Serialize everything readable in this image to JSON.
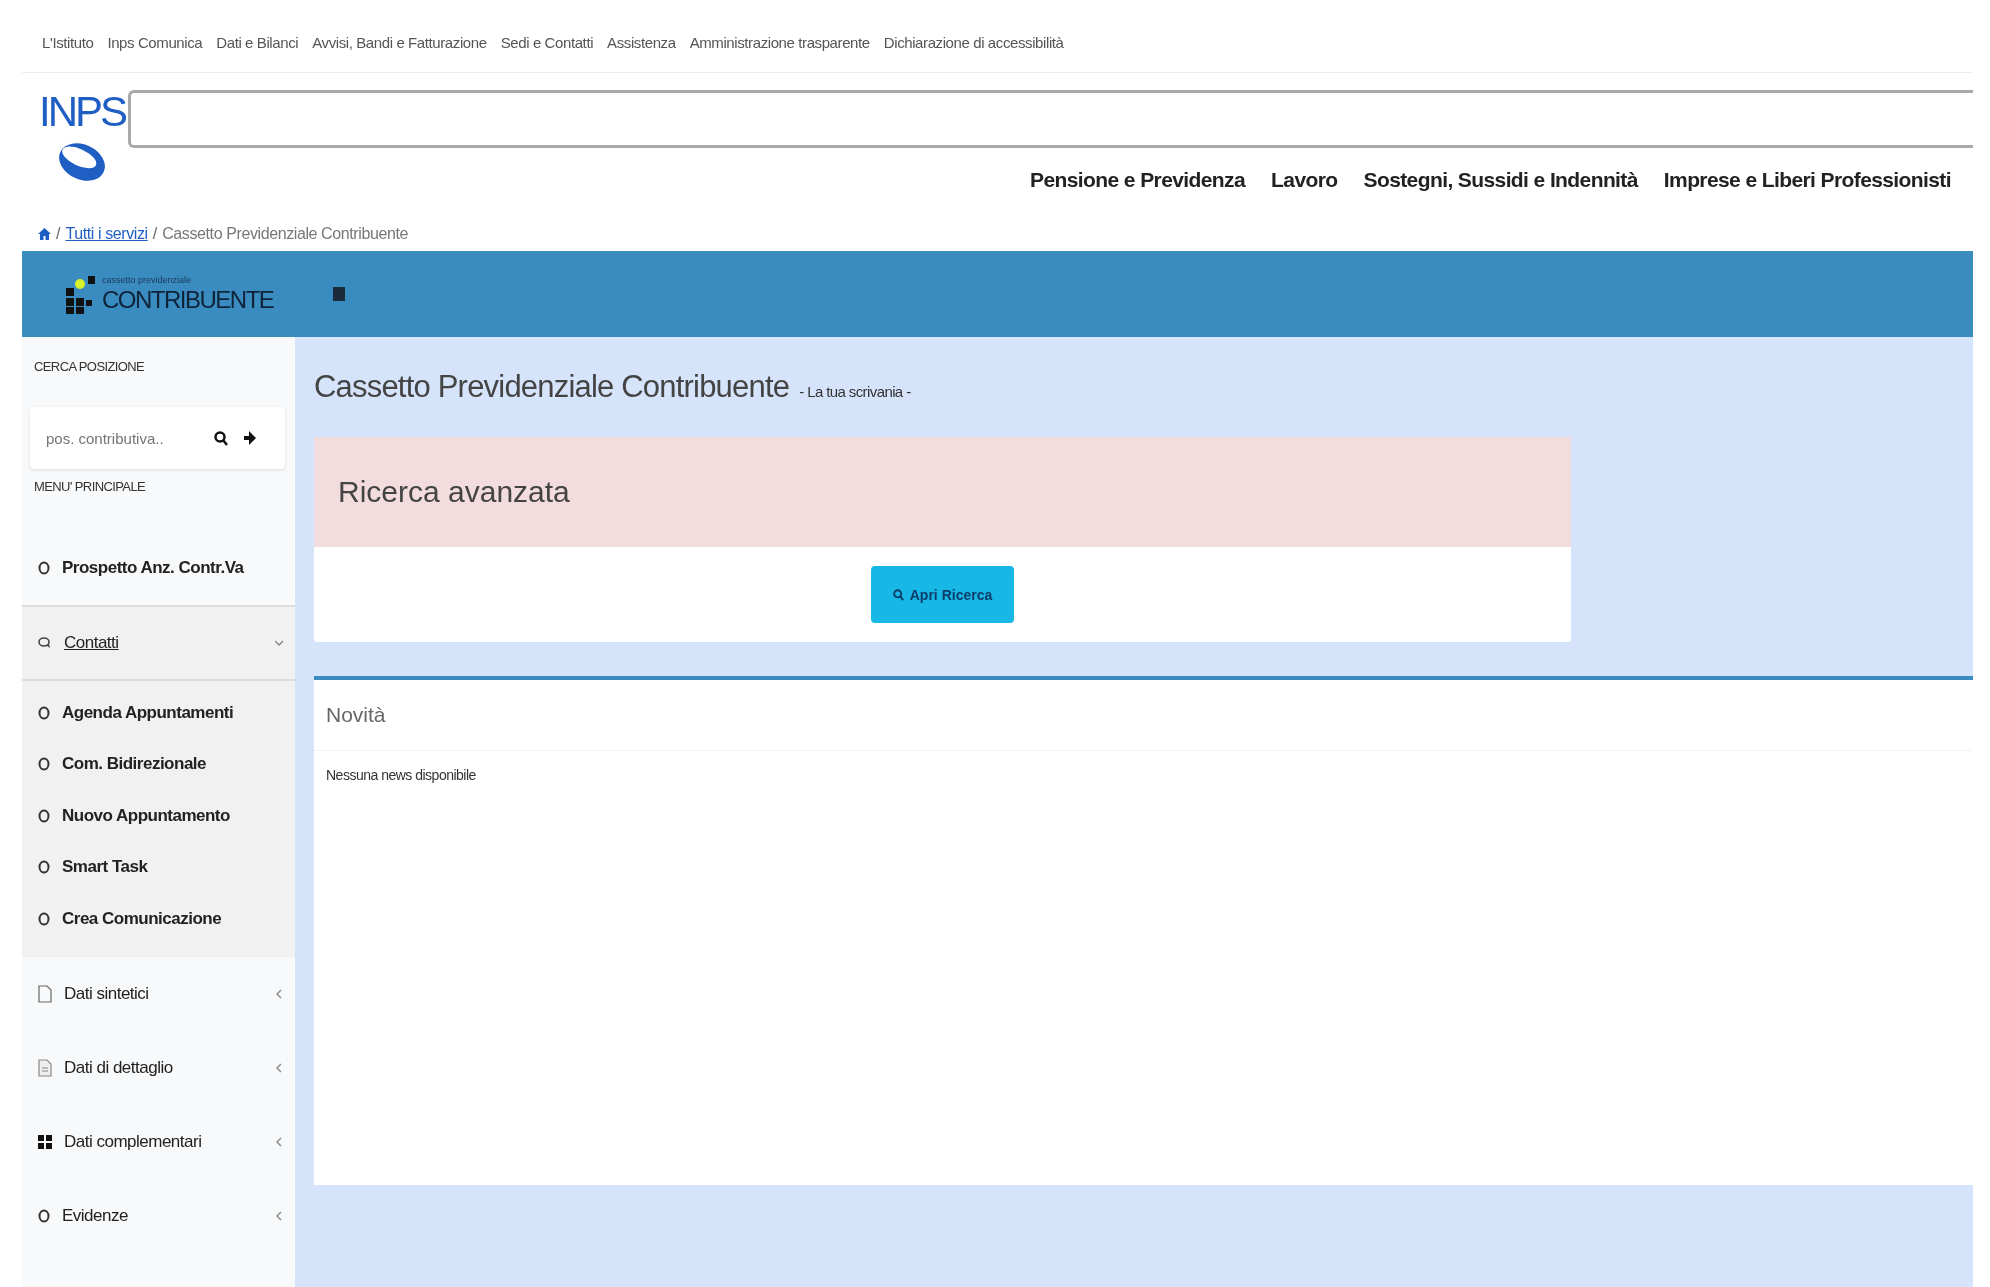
{
  "top_links": [
    "L'Istituto",
    "Inps Comunica",
    "Dati e Bilanci",
    "Avvisi, Bandi e Fatturazione",
    "Sedi e Contatti",
    "Assistenza",
    "Amministrazione trasparente",
    "Dichiarazione di accessibilità"
  ],
  "header": {
    "logo": "INPS",
    "nav": [
      "Pensione e Previdenza",
      "Lavoro",
      "Sostegni, Sussidi e Indennità",
      "Imprese e Liberi Professionisti"
    ]
  },
  "breadcrumb": [
    {
      "label": "/",
      "kind": "separator"
    },
    {
      "label": "Tutti i servizi",
      "kind": "link"
    },
    {
      "label": "/",
      "kind": "separator"
    },
    {
      "label": "Cassetto Previdenziale Contribuente",
      "kind": "current"
    }
  ],
  "app_bar": {
    "logo_small": "cassetto previdenziale",
    "logo": "CONTRIBUENTE"
  },
  "sidebar": {
    "search_heading": "CERCA POSIZIONE",
    "search": {
      "placeholder": "pos. contributiva.."
    },
    "menu_heading": "MENU' PRINCIPALE",
    "items": [
      {
        "label": "Prospetto Anz. Contr.Va",
        "kind": "item"
      },
      {
        "label": "Contatti",
        "kind": "group",
        "expanded": true,
        "children": [
          {
            "label": "Agenda Appuntamenti"
          },
          {
            "label": "Com. Bidirezionale"
          },
          {
            "label": "Nuovo Appuntamento"
          },
          {
            "label": "Smart Task"
          },
          {
            "label": "Crea Comunicazione"
          }
        ]
      },
      {
        "label": "Dati sintetici",
        "kind": "group",
        "expanded": false
      },
      {
        "label": "Dati di dettaglio",
        "kind": "group",
        "expanded": false
      },
      {
        "label": "Dati complementari",
        "kind": "group",
        "expanded": false
      },
      {
        "label": "Evidenze",
        "kind": "group",
        "expanded": false
      }
    ]
  },
  "main": {
    "title": "Cassetto Previdenziale Contribuente",
    "subtitle": "- La tua scrivania -",
    "search_panel": {
      "title": "Ricerca avanzata",
      "button": "Apri Ricerca"
    },
    "news_panel": {
      "title": "Novità",
      "message": "Nessuna news disponibile"
    }
  }
}
